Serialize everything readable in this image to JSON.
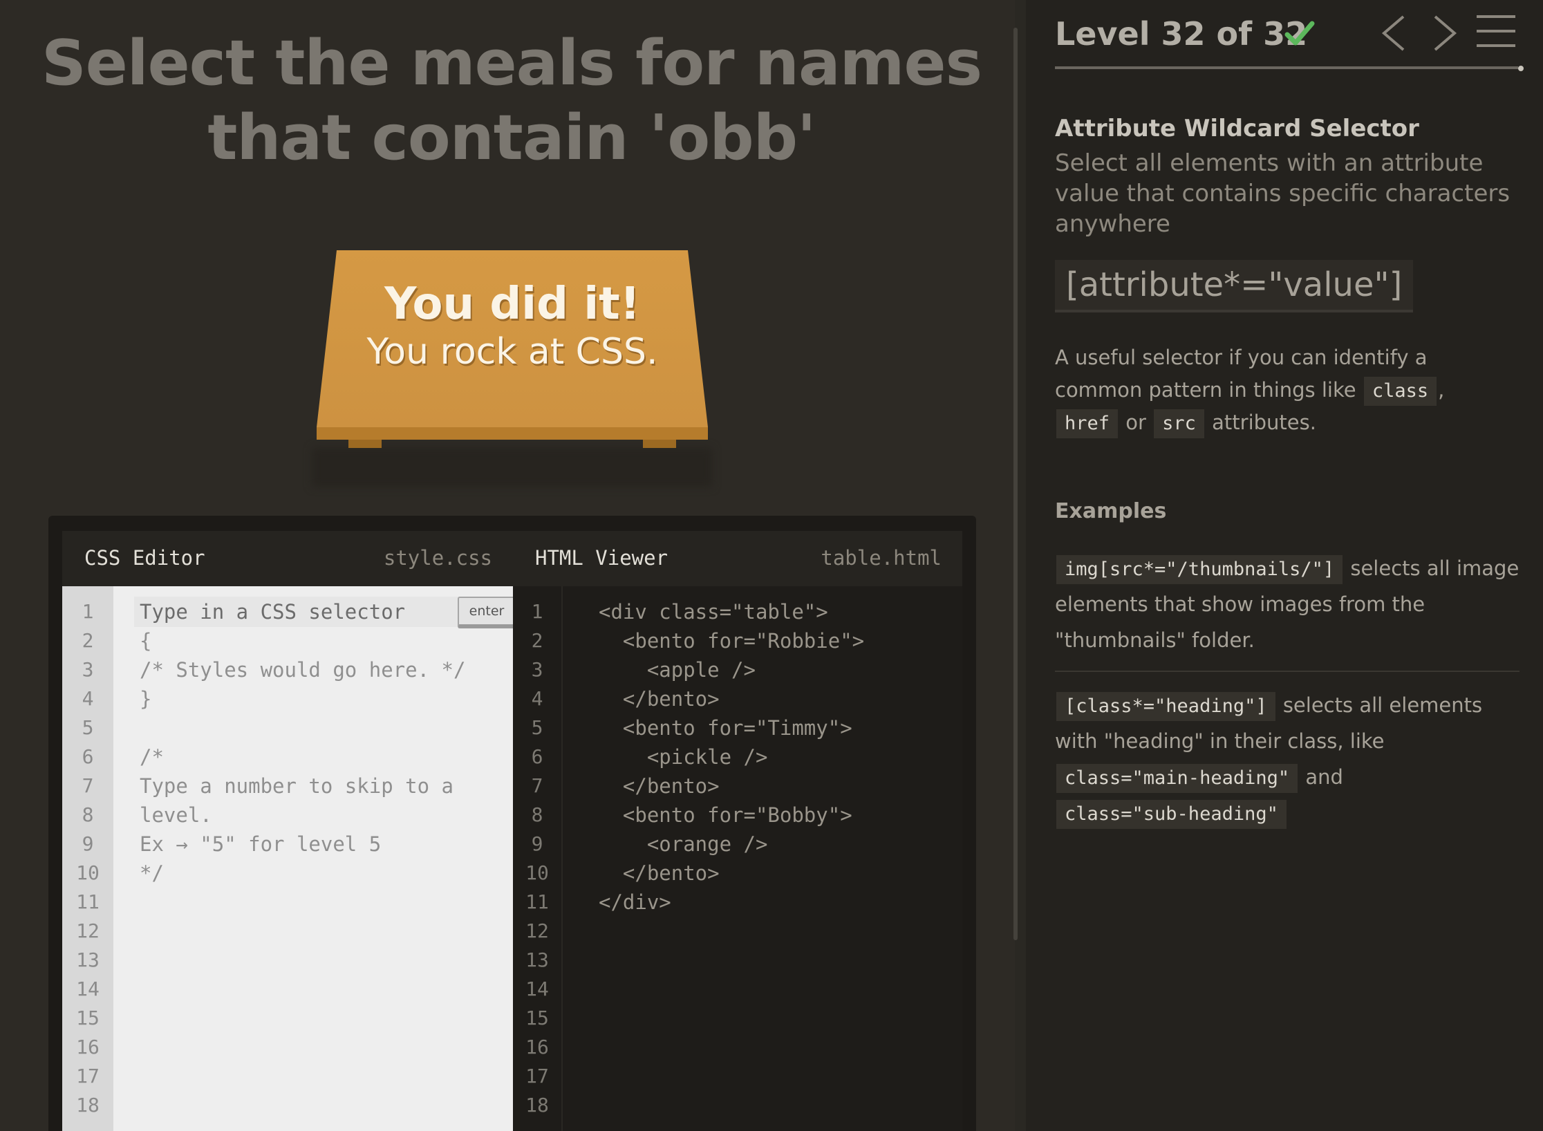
{
  "game": {
    "order": "Select the meals for names that contain 'obb'",
    "success_title": "You did it!",
    "success_subtitle": "You rock at CSS."
  },
  "css_editor": {
    "title": "CSS Editor",
    "filename": "style.css",
    "input_placeholder": "Type in a CSS selector",
    "enter_label": "enter",
    "lines": [
      "{",
      "/* Styles would go here. */",
      "}",
      "",
      "/*",
      "Type a number to skip to a",
      "level.",
      "Ex → \"5\" for level 5",
      "*/"
    ],
    "line_numbers": [
      "1",
      "2",
      "3",
      "4",
      "5",
      "6",
      "7",
      "8",
      "9",
      "10",
      "11",
      "12",
      "13",
      "14",
      "15",
      "16",
      "17",
      "18"
    ]
  },
  "html_viewer": {
    "title": "HTML Viewer",
    "filename": "table.html",
    "lines": [
      "<div class=\"table\">",
      "  <bento for=\"Robbie\">",
      "    <apple />",
      "  </bento>",
      "  <bento for=\"Timmy\">",
      "    <pickle />",
      "  </bento>",
      "  <bento for=\"Bobby\">",
      "    <orange />",
      "  </bento>",
      "</div>"
    ],
    "line_numbers": [
      "1",
      "2",
      "3",
      "4",
      "5",
      "6",
      "7",
      "8",
      "9",
      "10",
      "11",
      "12",
      "13",
      "14",
      "15",
      "16",
      "17",
      "18"
    ]
  },
  "sidebar": {
    "level_title": "Level 32 of 32",
    "progress": 1.0,
    "check_icon": "checkmark-icon",
    "selector_name": "Attribute Wildcard Selector",
    "selector_title": "Select all elements with an attribute value that contains specific characters anywhere",
    "syntax": "[attribute*=\"value\"]",
    "hint": {
      "part1": "A useful selector if you can identify a common pattern in things like",
      "tag1": "class",
      "sep1": ",",
      "tag2": "href",
      "sep2": "or",
      "tag3": "src",
      "part2": "attributes."
    },
    "examples_heading": "Examples",
    "example1": {
      "code": "img[src*=\"/thumbnails/\"]",
      "text": "selects all image elements that show images from the \"thumbnails\" folder."
    },
    "example2": {
      "code": "[class*=\"heading\"]",
      "text1": "selects all elements with \"heading\" in their class, like",
      "code2": "class=\"main-heading\"",
      "and": "and",
      "code3": "class=\"sub-heading\""
    }
  },
  "colors": {
    "table": "#d59944",
    "check": "#5cb85c",
    "background": "#2d2a25"
  }
}
